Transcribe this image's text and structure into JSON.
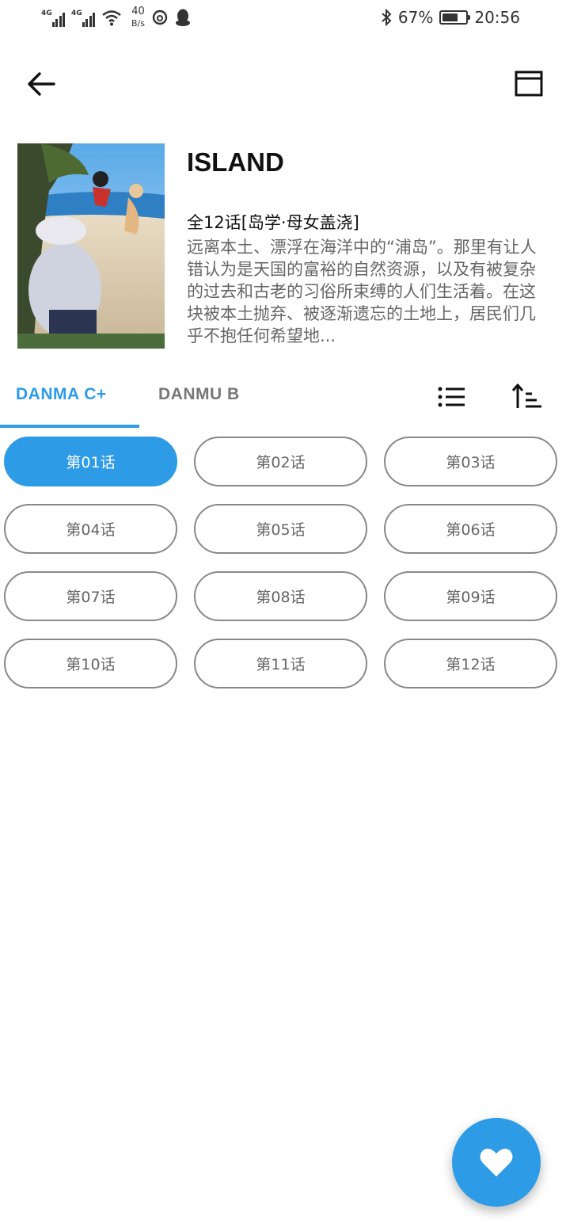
{
  "status_bar": {
    "net_type_1": "4G",
    "net_type_2": "4G",
    "net_speed_value": "40",
    "net_speed_unit": "B/s",
    "battery_percent": "67%",
    "battery_level": 0.67,
    "time": "20:56"
  },
  "anime": {
    "title": "ISLAND",
    "meta": "全12话[岛学·母女盖浇]",
    "description": "远离本土、漂浮在海洋中的“浦岛”。那里有让人错认为是天国的富裕的自然资源，以及有被复杂的过去和古老的习俗所束缚的人们生活着。在这块被本土抛弃、被逐渐遗忘的土地上，居民们几乎不抱任何希望地..."
  },
  "tabs": [
    {
      "label": "DANMA C+",
      "active": true
    },
    {
      "label": "DANMU B",
      "active": false
    }
  ],
  "episodes": [
    "第01话",
    "第02话",
    "第03话",
    "第04话",
    "第05话",
    "第06话",
    "第07话",
    "第08话",
    "第09话",
    "第10话",
    "第11话",
    "第12话"
  ],
  "selected_episode": 0,
  "colors": {
    "accent": "#2d9be6",
    "outline": "#888888",
    "text_secondary": "#666666"
  },
  "icons": {
    "back": "arrow-left-icon",
    "window": "window-icon",
    "list": "list-icon",
    "sort": "sort-ascending-icon",
    "favorite": "heart-icon"
  }
}
